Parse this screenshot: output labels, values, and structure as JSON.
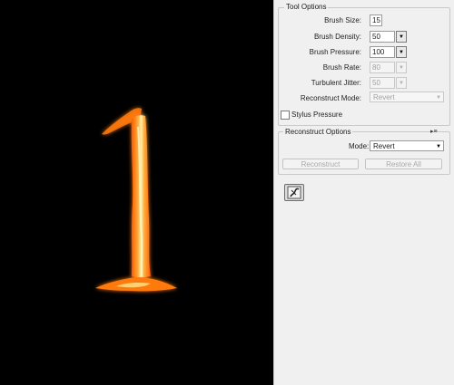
{
  "tool_options": {
    "title": "Tool Options",
    "brush_size": {
      "label": "Brush Size:",
      "value": "15"
    },
    "brush_density": {
      "label": "Brush Density:",
      "value": "50"
    },
    "brush_pressure": {
      "label": "Brush Pressure:",
      "value": "100"
    },
    "brush_rate": {
      "label": "Brush Rate:",
      "value": "80"
    },
    "turbulent_jitter": {
      "label": "Turbulent Jitter:",
      "value": "50"
    },
    "reconstruct_mode": {
      "label": "Reconstruct Mode:",
      "value": "Revert"
    },
    "stylus_pressure": {
      "label": "Stylus Pressure",
      "checked": false
    }
  },
  "reconstruct_options": {
    "title": "Reconstruct Options",
    "mode": {
      "label": "Mode:",
      "value": "Revert"
    },
    "reconstruct_label": "Reconstruct",
    "restore_all_label": "Restore All"
  },
  "icons": {
    "canvas_art": "flaming-number-one",
    "panel_menu": "panel-menu-icon",
    "tool_button": "liquify-brush-icon"
  },
  "colors": {
    "canvas_bg": "#000000",
    "panel_bg": "#f0f0f0",
    "flame_core": "#ffe08a",
    "flame_outer": "#ff6a00"
  }
}
